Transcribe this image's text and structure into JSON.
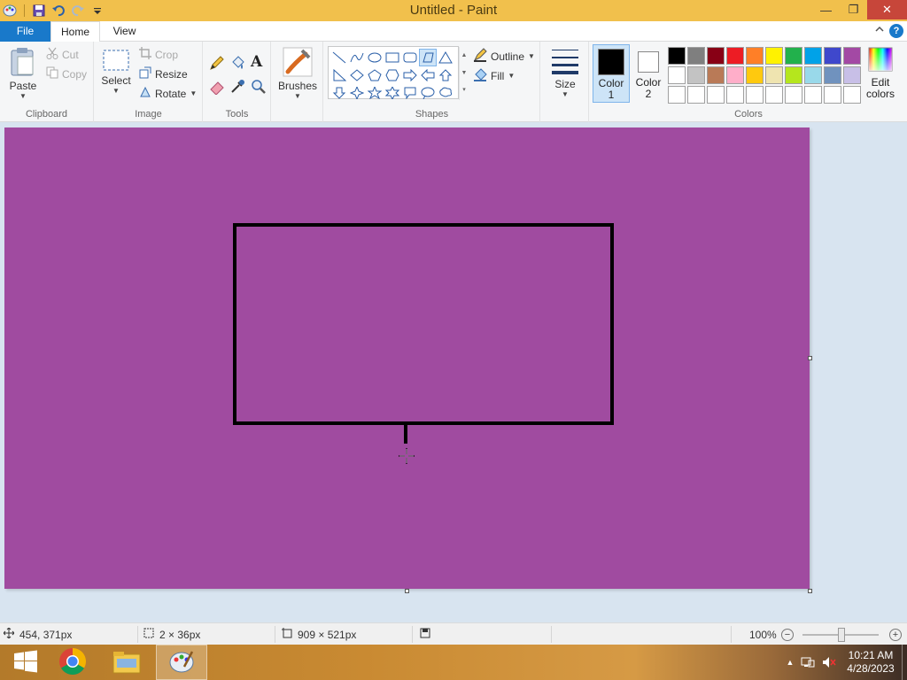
{
  "window": {
    "title": "Untitled - Paint",
    "min_glyph": "—",
    "max_glyph": "❐",
    "close_glyph": "✕"
  },
  "quick_access": [
    "paint-app-icon",
    "save-icon",
    "undo-icon",
    "redo-icon",
    "customize-icon"
  ],
  "tabs": {
    "file": "File",
    "home": "Home",
    "view": "View",
    "help": "?"
  },
  "clipboard": {
    "paste": "Paste",
    "cut": "Cut",
    "copy": "Copy",
    "label": "Clipboard"
  },
  "image": {
    "select": "Select",
    "crop": "Crop",
    "resize": "Resize",
    "rotate": "Rotate",
    "label": "Image"
  },
  "tools": {
    "label": "Tools",
    "text_glyph": "A"
  },
  "brushes": {
    "label": "Brushes"
  },
  "shapes": {
    "outline": "Outline",
    "fill": "Fill",
    "label": "Shapes"
  },
  "size": {
    "label": "Size"
  },
  "colors": {
    "color1_label": "Color\n1",
    "color2_label": "Color\n2",
    "edit_label": "Edit\ncolors",
    "label": "Colors",
    "color1": "#000000",
    "color2": "#ffffff",
    "palette": [
      "#000000",
      "#7f7f7f",
      "#880015",
      "#ed1c24",
      "#ff7f27",
      "#fff200",
      "#22b14c",
      "#00a2e8",
      "#3f48cc",
      "#a349a4",
      "#ffffff",
      "#c3c3c3",
      "#b97a57",
      "#ffaec9",
      "#ffc90e",
      "#efe4b0",
      "#b5e61d",
      "#99d9ea",
      "#7092be",
      "#c8bfe7",
      "#ffffff",
      "#ffffff",
      "#ffffff",
      "#ffffff",
      "#ffffff",
      "#ffffff",
      "#ffffff",
      "#ffffff",
      "#ffffff",
      "#ffffff"
    ]
  },
  "canvas": {
    "background": "#a04ba0",
    "stroke": "#000000"
  },
  "status": {
    "cursor_pos": "454, 371px",
    "selection_size": "2 × 36px",
    "image_size": "909 × 521px",
    "zoom": "100%",
    "zoom_out": "−",
    "zoom_in": "+"
  },
  "taskbar": {
    "time": "10:21 AM",
    "date": "4/28/2023"
  }
}
